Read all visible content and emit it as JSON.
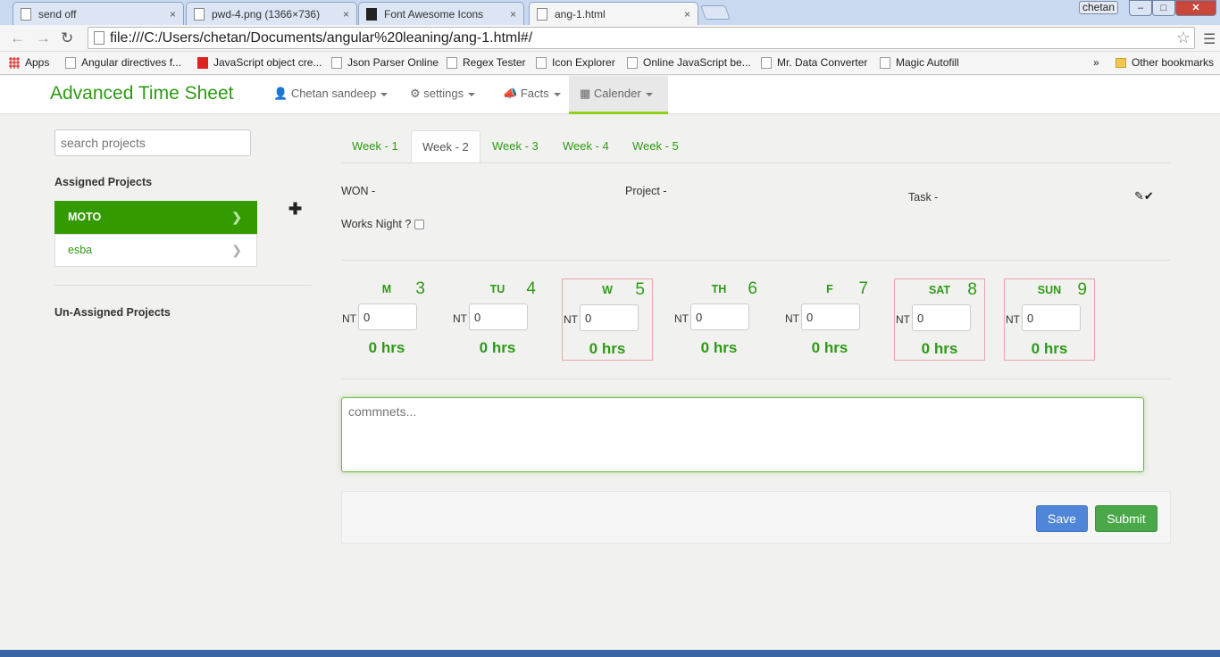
{
  "browser": {
    "tabs": [
      {
        "title": "send off",
        "close": "×"
      },
      {
        "title": "pwd-4.png (1366×736)",
        "close": "×"
      },
      {
        "title": "Font Awesome Icons",
        "close": "×"
      },
      {
        "title": "ang-1.html",
        "close": "×"
      }
    ],
    "user": "chetan",
    "url": "file:///C:/Users/chetan/Documents/angular%20leaning/ang-1.html#/",
    "bookmarks": [
      "Apps",
      "Angular directives f...",
      "JavaScript object cre...",
      "Json Parser Online",
      "Regex Tester",
      "Icon Explorer",
      "Online JavaScript be...",
      "Mr. Data Converter",
      "Magic Autofill"
    ],
    "more": "»",
    "other_bookmarks": "Other bookmarks"
  },
  "app": {
    "brand": "Advanced Time Sheet",
    "nav": {
      "user": "Chetan sandeep",
      "settings": "settings",
      "facts": "Facts",
      "calender": "Calender"
    }
  },
  "sidebar": {
    "search_placeholder": "search projects",
    "assigned_heading": "Assigned Projects",
    "projects": [
      {
        "name": "MOTO",
        "selected": true
      },
      {
        "name": "esba",
        "selected": false
      }
    ],
    "unassigned_heading": "Un-Assigned Projects"
  },
  "weeks": [
    "Week - 1",
    "Week - 2",
    "Week - 3",
    "Week - 4",
    "Week - 5"
  ],
  "active_week": "Week - 2",
  "info": {
    "won": "WON -",
    "project": "Project -",
    "task": "Task -",
    "works_night": "Works Night ?"
  },
  "days": [
    {
      "name": "M",
      "date": "3",
      "nt_label": "NT",
      "nt_value": "0",
      "hours": "0 hrs",
      "highlight": false
    },
    {
      "name": "TU",
      "date": "4",
      "nt_label": "NT",
      "nt_value": "0",
      "hours": "0 hrs",
      "highlight": false
    },
    {
      "name": "W",
      "date": "5",
      "nt_label": "NT",
      "nt_value": "0",
      "hours": "0 hrs",
      "highlight": true
    },
    {
      "name": "TH",
      "date": "6",
      "nt_label": "NT",
      "nt_value": "0",
      "hours": "0 hrs",
      "highlight": false
    },
    {
      "name": "F",
      "date": "7",
      "nt_label": "NT",
      "nt_value": "0",
      "hours": "0 hrs",
      "highlight": false
    },
    {
      "name": "SAT",
      "date": "8",
      "nt_label": "NT",
      "nt_value": "0",
      "hours": "0 hrs",
      "highlight": true
    },
    {
      "name": "SUN",
      "date": "9",
      "nt_label": "NT",
      "nt_value": "0",
      "hours": "0 hrs",
      "highlight": true
    }
  ],
  "comments_placeholder": "commnets...",
  "buttons": {
    "save": "Save",
    "submit": "Submit"
  },
  "colors": {
    "brand_green": "#2e9a15",
    "selected_project": "#339a00",
    "save_blue": "#4f86d8",
    "submit_green": "#4aa84a"
  }
}
